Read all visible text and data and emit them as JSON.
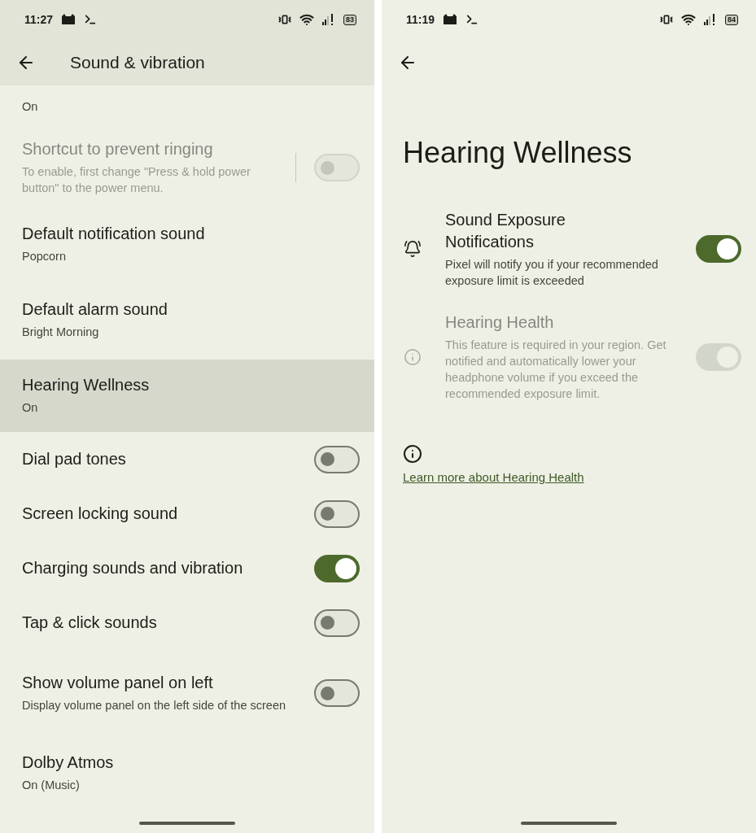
{
  "sound_vibration": {
    "status_bar": {
      "time": "11:27",
      "battery": "83"
    },
    "title": "Sound & vibration",
    "rows": [
      {
        "kind": "nav",
        "subtitle": "On",
        "selected": false,
        "disabled": false
      },
      {
        "kind": "toggle",
        "title": "Shortcut to prevent ringing",
        "subtitle": "To enable, first change \"Press & hold power button\" to the power menu.",
        "on": false,
        "disabled": true,
        "selected": false,
        "divider": true
      },
      {
        "kind": "nav",
        "title": "Default notification sound",
        "subtitle": "Popcorn",
        "selected": false,
        "disabled": false
      },
      {
        "kind": "nav",
        "title": "Default alarm sound",
        "subtitle": "Bright Morning",
        "selected": false,
        "disabled": false
      },
      {
        "kind": "nav",
        "title": "Hearing Wellness",
        "subtitle": "On",
        "selected": true,
        "disabled": false
      },
      {
        "kind": "toggle",
        "title": "Dial pad tones",
        "on": false,
        "disabled": false,
        "selected": false
      },
      {
        "kind": "toggle",
        "title": "Screen locking sound",
        "on": false,
        "disabled": false,
        "selected": false
      },
      {
        "kind": "toggle",
        "title": "Charging sounds and vibration",
        "on": true,
        "disabled": false,
        "selected": false
      },
      {
        "kind": "toggle",
        "title": "Tap & click sounds",
        "on": false,
        "disabled": false,
        "selected": false
      },
      {
        "kind": "toggle",
        "title": "Show volume panel on left",
        "subtitle": "Display volume panel on the left side of the screen",
        "on": false,
        "disabled": false,
        "selected": false
      },
      {
        "kind": "nav",
        "title": "Dolby Atmos",
        "subtitle": "On (Music)",
        "selected": false,
        "disabled": false
      }
    ]
  },
  "hearing_wellness": {
    "status_bar": {
      "time": "11:19",
      "battery": "84"
    },
    "title": "Hearing Wellness",
    "rows": [
      {
        "kind": "bell",
        "title": "Sound Exposure Notifications",
        "subtitle": "Pixel will notify you if your recommended exposure limit is exceeded",
        "on": true,
        "disabled": false
      },
      {
        "kind": "info",
        "title": "Hearing Health",
        "subtitle": "This feature is required in your region. Get notified and automatically lower your headphone volume if you exceed the recommended exposure limit.",
        "on": true,
        "disabled": true
      }
    ],
    "link": "Learn more about Hearing Health"
  }
}
